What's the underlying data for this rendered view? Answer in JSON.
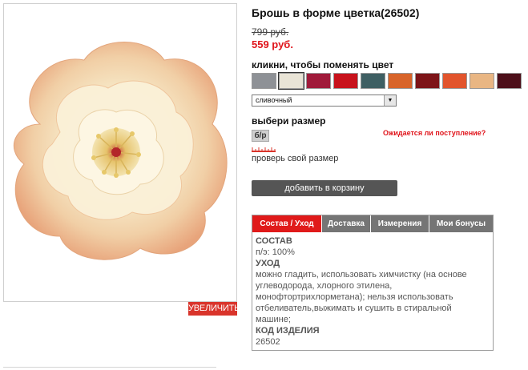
{
  "product": {
    "title": "Брошь в форме цветка(26502)",
    "old_price": "799 руб.",
    "new_price": "559 руб.",
    "image_icon": "flower-brooch-photo",
    "zoom_label": "УВЕЛИЧИТЬ"
  },
  "color": {
    "label": "кликни, чтобы поменять цвет",
    "selected": "сливочный",
    "swatches": [
      {
        "name": "gray",
        "color": "#8e9196"
      },
      {
        "name": "cream-white",
        "color": "#e9e4d6"
      },
      {
        "name": "crimson",
        "color": "#a01a3a"
      },
      {
        "name": "red",
        "color": "#c8121c"
      },
      {
        "name": "teal",
        "color": "#3e5f63"
      },
      {
        "name": "orange",
        "color": "#d8642a"
      },
      {
        "name": "dark-red",
        "color": "#7d1418"
      },
      {
        "name": "coral",
        "color": "#e2542c"
      },
      {
        "name": "peach",
        "color": "#e9b683"
      },
      {
        "name": "burgundy",
        "color": "#4d0f1a"
      }
    ]
  },
  "size": {
    "label": "выбери размер",
    "option": "б/р",
    "notify": "Ожидается ли поступление?",
    "check_link": "проверь свой размер"
  },
  "cart": {
    "add_label": "добавить в корзину"
  },
  "tabs": {
    "items": [
      "Состав / Уход",
      "Доставка",
      "Измерения",
      "Мои бонусы"
    ],
    "active": 0
  },
  "details": {
    "composition_head": "СОСТАВ",
    "composition": "п/э: 100%",
    "care_head": "УХОД",
    "care_1": "можно гладить, использовать химчистку (на основе",
    "care_2": "углеводорода, хлорного этилена,",
    "care_3": "монофтортрихлорметана); нельзя использовать",
    "care_4": "отбеливатель,выжимать и сушить в стиральной",
    "care_5": "машине;",
    "code_head": "КОД ИЗДЕЛИЯ",
    "code": "26502"
  },
  "colors": {
    "accent_red": "#e01a1a",
    "tab_gray": "#757575",
    "button_gray": "#555555"
  }
}
